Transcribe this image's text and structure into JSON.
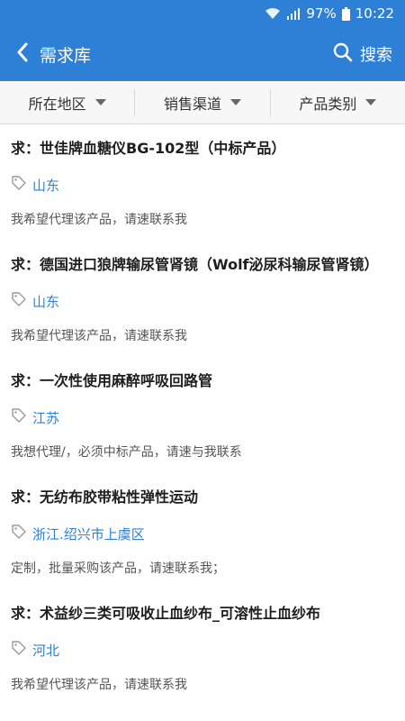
{
  "status_bar": {
    "battery": "97%",
    "time": "10:22"
  },
  "header": {
    "back_icon": "chevron-left-icon",
    "title": "需求库",
    "search_icon": "search-icon",
    "search_label": "搜索"
  },
  "filters": [
    {
      "label": "所在地区"
    },
    {
      "label": "销售渠道"
    },
    {
      "label": "产品类别"
    }
  ],
  "items": [
    {
      "title": "求：世佳牌血糖仪BG-102型（中标产品）",
      "location": "山东",
      "desc": "我希望代理该产品，请速联系我"
    },
    {
      "title": "求：德国进口狼牌输尿管肾镜（Wolf泌尿科输尿管肾镜）",
      "location": "山东",
      "desc": "我希望代理该产品，请速联系我"
    },
    {
      "title": "求：一次性使用麻醉呼吸回路管",
      "location": "江苏",
      "desc": "我想代理/，必须中标产品，请速与我联系"
    },
    {
      "title": "求：无纺布胶带粘性弹性运动",
      "location": "浙江.绍兴市上虞区",
      "desc": "定制，批量采购该产品，请速联系我；"
    },
    {
      "title": "求：术益纱三类可吸收止血纱布_可溶性止血纱布",
      "location": "河北",
      "desc": "我希望代理该产品，请速联系我"
    }
  ],
  "colors": {
    "primary": "#2d80d6",
    "location_text": "#2d80d6",
    "title_text": "#1e1e1e"
  }
}
